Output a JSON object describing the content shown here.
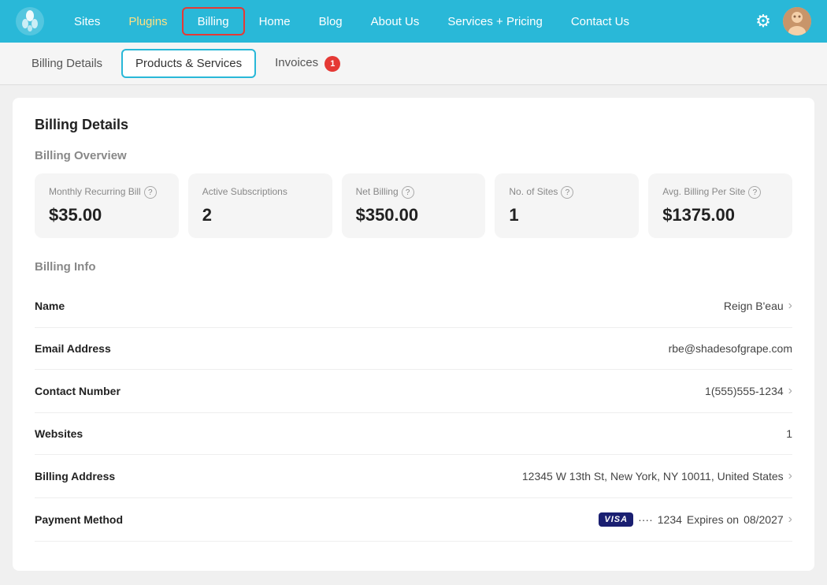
{
  "nav": {
    "items": [
      {
        "label": "Sites",
        "id": "sites",
        "active": false,
        "special": null
      },
      {
        "label": "Plugins",
        "id": "plugins",
        "active": false,
        "special": "plugins"
      },
      {
        "label": "Billing",
        "id": "billing",
        "active": true,
        "special": "billing"
      },
      {
        "label": "Home",
        "id": "home",
        "active": false,
        "special": null
      },
      {
        "label": "Blog",
        "id": "blog",
        "active": false,
        "special": null
      },
      {
        "label": "About Us",
        "id": "about",
        "active": false,
        "special": null
      },
      {
        "label": "Services + Pricing",
        "id": "services",
        "active": false,
        "special": null
      },
      {
        "label": "Contact Us",
        "id": "contact",
        "active": false,
        "special": null
      }
    ]
  },
  "subnav": {
    "items": [
      {
        "label": "Billing Details",
        "id": "billing-details",
        "active": false,
        "badge": null
      },
      {
        "label": "Products & Services",
        "id": "products-services",
        "active": true,
        "badge": null
      },
      {
        "label": "Invoices",
        "id": "invoices",
        "active": false,
        "badge": "1"
      }
    ]
  },
  "page": {
    "title": "Billing Details",
    "overview_title": "Billing Overview",
    "info_title": "Billing Info"
  },
  "overview_cards": [
    {
      "id": "monthly-recurring",
      "label": "Monthly Recurring Bill",
      "value": "$35.00",
      "has_help": true
    },
    {
      "id": "active-subscriptions",
      "label": "Active Subscriptions",
      "value": "2",
      "has_help": false
    },
    {
      "id": "net-billing",
      "label": "Net Billing",
      "value": "$350.00",
      "has_help": true
    },
    {
      "id": "no-of-sites",
      "label": "No. of Sites",
      "value": "1",
      "has_help": true
    },
    {
      "id": "avg-billing",
      "label": "Avg. Billing Per Site",
      "value": "$1375.00",
      "has_help": true
    }
  ],
  "billing_info": {
    "rows": [
      {
        "label": "Name",
        "value": "Reign B'eau",
        "has_chevron": true
      },
      {
        "label": "Email Address",
        "value": "rbe@shadesofgrape.com",
        "has_chevron": false
      },
      {
        "label": "Contact Number",
        "value": "1(555)555-1234",
        "has_chevron": true
      },
      {
        "label": "Websites",
        "value": "1",
        "has_chevron": false
      },
      {
        "label": "Billing Address",
        "value": "12345 W 13th St, New York, NY 10011, United States",
        "has_chevron": true
      },
      {
        "label": "Payment Method",
        "value": "payment-method",
        "has_chevron": true,
        "special": "payment"
      }
    ],
    "payment": {
      "visa_label": "VISA",
      "dots": "····",
      "last4": "1234",
      "expires_label": "Expires on",
      "expires_date": "08/2027"
    }
  }
}
